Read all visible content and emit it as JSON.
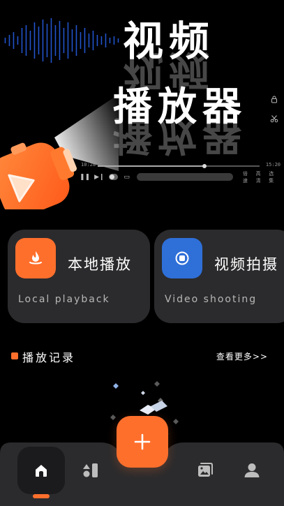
{
  "hero": {
    "title_line1": "视频",
    "title_line2": "播放器",
    "player": {
      "time_current": "10:28",
      "time_total": "15:20",
      "progress": 0.66,
      "speed_label": "倍速",
      "quality_label": "高清",
      "episodes_label": "选集"
    },
    "side_icons": [
      "lock-icon",
      "scissors-icon"
    ]
  },
  "features": [
    {
      "title": "本地播放",
      "subtitle": "Local playback",
      "icon": "flame-icon",
      "color": "#ff6f2c"
    },
    {
      "title": "视频拍摄",
      "subtitle": "Video shooting",
      "icon": "record-icon",
      "color": "#2f6fd8"
    }
  ],
  "history": {
    "title": "播放记录",
    "more_label": "查看更多>>"
  },
  "nav": {
    "items": [
      "home-icon",
      "stats-icon",
      "add-icon",
      "gallery-icon",
      "user-icon"
    ],
    "active": "home-icon",
    "accent": "#ff6f2c"
  }
}
